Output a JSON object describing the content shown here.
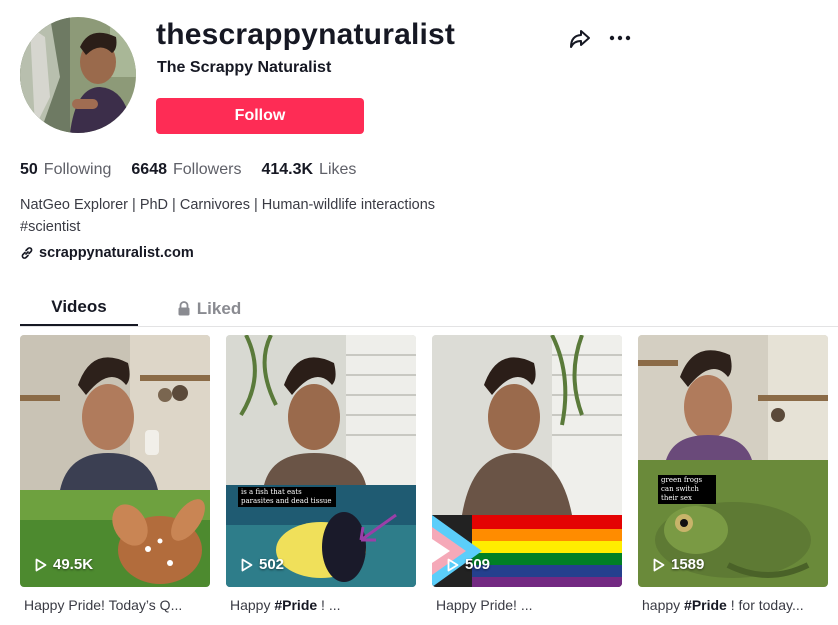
{
  "profile": {
    "username": "thescrappynaturalist",
    "nickname": "The Scrappy Naturalist",
    "follow_label": "Follow",
    "share_icon": "share-arrow-icon",
    "more_icon": "more-dots-icon"
  },
  "stats": {
    "following_count": "50",
    "following_label": "Following",
    "followers_count": "6648",
    "followers_label": "Followers",
    "likes_count": "414.3K",
    "likes_label": "Likes"
  },
  "bio": {
    "line1": "NatGeo Explorer | PhD | Carnivores | Human-wildlife interactions",
    "line2": "#scientist"
  },
  "link": {
    "text": "scrappynaturalist.com",
    "icon": "link-icon"
  },
  "tabs": [
    {
      "label": "Videos",
      "active": true
    },
    {
      "label": "Liked",
      "icon": "lock-icon",
      "active": false
    }
  ],
  "videos": [
    {
      "views": "49.5K",
      "caption_plain": "Happy Pride! Today’s Q...",
      "caption_prefix": "",
      "caption_tag": "",
      "caption_suffix": ""
    },
    {
      "views": "502",
      "caption_plain": "",
      "caption_prefix": "Happy ",
      "caption_tag": "#Pride",
      "caption_suffix": " ! ...",
      "overlay": "is a fish that eats parasites and dead tissue"
    },
    {
      "views": "509",
      "caption_plain": "Happy Pride! ...",
      "caption_prefix": "",
      "caption_tag": "",
      "caption_suffix": ""
    },
    {
      "views": "1589",
      "caption_plain": "",
      "caption_prefix": "happy ",
      "caption_tag": "#Pride",
      "caption_suffix": " ! for today...",
      "overlay": "green frogs can switch their sex"
    }
  ],
  "colors": {
    "follow_button": "#fe2c55",
    "primary_text": "#161823",
    "secondary_text": "#5f6068"
  }
}
